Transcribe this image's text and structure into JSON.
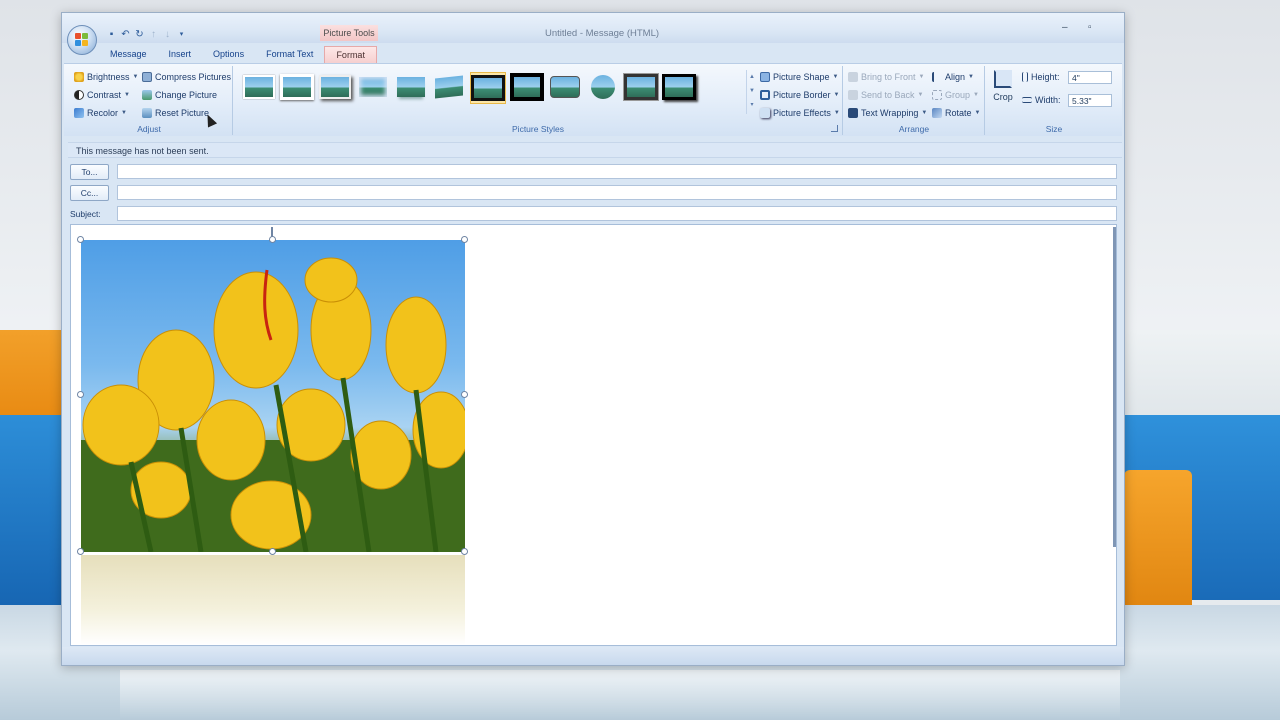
{
  "window": {
    "title": "Untitled - Message (HTML)",
    "context_tab_header": "Picture Tools",
    "controls": [
      "–",
      "▫"
    ]
  },
  "tabs": [
    "Message",
    "Insert",
    "Options",
    "Format Text",
    "Format"
  ],
  "ribbon": {
    "adjust": {
      "label": "Adjust",
      "brightness": "Brightness",
      "contrast": "Contrast",
      "recolor": "Recolor",
      "compress": "Compress Pictures",
      "change": "Change Picture",
      "reset": "Reset Picture"
    },
    "picture_styles": {
      "label": "Picture Styles",
      "shape": "Picture Shape",
      "border": "Picture Border",
      "effects": "Picture Effects"
    },
    "arrange": {
      "label": "Arrange",
      "bring_front": "Bring to Front",
      "send_back": "Send to Back",
      "text_wrapping": "Text Wrapping",
      "align": "Align",
      "group": "Group",
      "rotate": "Rotate"
    },
    "size": {
      "label": "Size",
      "crop": "Crop",
      "height_label": "Height:",
      "height_value": "4\"",
      "width_label": "Width:",
      "width_value": "5.33\""
    }
  },
  "message": {
    "notice": "This message has not been sent.",
    "to_button": "To...",
    "cc_button": "Cc...",
    "subject_label": "Subject:",
    "to_value": "",
    "cc_value": "",
    "subject_value": ""
  },
  "icons": {
    "office_button": "office-logo-icon",
    "brightness": "sun-icon",
    "contrast": "contrast-icon",
    "recolor": "recolor-icon",
    "crop": "crop-icon"
  },
  "colors": {
    "ribbon_bg": "#dbe7f6",
    "context_tab": "#f3c6c6",
    "accent_text": "#15428b"
  }
}
